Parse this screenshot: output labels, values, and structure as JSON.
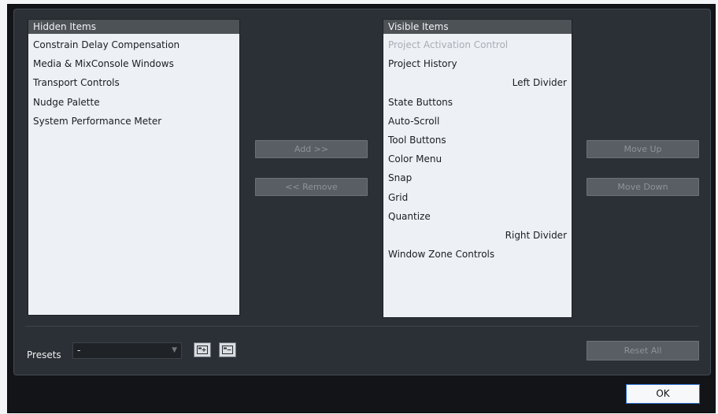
{
  "hidden_list": {
    "header": "Hidden Items",
    "items": [
      {
        "label": "Constrain Delay Compensation"
      },
      {
        "label": "Media & MixConsole Windows"
      },
      {
        "label": "Transport Controls"
      },
      {
        "label": "Nudge Palette"
      },
      {
        "label": "System Performance Meter"
      }
    ]
  },
  "visible_list": {
    "header": "Visible Items",
    "items": [
      {
        "label": "Project Activation Control",
        "disabled": true
      },
      {
        "label": "Project History"
      },
      {
        "label": "Left Divider",
        "align": "right"
      },
      {
        "label": "State Buttons"
      },
      {
        "label": "Auto-Scroll"
      },
      {
        "label": "Tool Buttons"
      },
      {
        "label": "Color Menu"
      },
      {
        "label": "Snap"
      },
      {
        "label": "Grid"
      },
      {
        "label": "Quantize"
      },
      {
        "label": "Right Divider",
        "align": "right"
      },
      {
        "label": "Window Zone Controls"
      }
    ]
  },
  "transfer": {
    "add_label": "Add >>",
    "remove_label": "<< Remove"
  },
  "order": {
    "move_up_label": "Move Up",
    "move_down_label": "Move Down"
  },
  "presets": {
    "label": "Presets",
    "value": "-",
    "save_icon": "save-preset-icon",
    "delete_icon": "remove-preset-icon"
  },
  "reset_label": "Reset All",
  "ok_label": "OK"
}
